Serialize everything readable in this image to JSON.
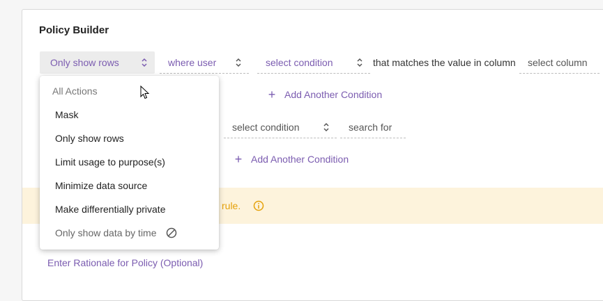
{
  "builder": {
    "title": "Policy Builder"
  },
  "row1": {
    "action_select": "Only show rows",
    "user_select": "where user",
    "condition_select": "select condition",
    "middle_text": "that matches the value in column",
    "column_select": "select column"
  },
  "add_condition_1": "Add Another Condition",
  "row2": {
    "condition_select": "select condition",
    "search_input": "search for"
  },
  "add_condition_2": "Add Another Condition",
  "warning": {
    "text": "rule.",
    "color": "#e5a10a"
  },
  "rationale_link": "Enter Rationale for Policy (Optional)",
  "dropdown": {
    "header": "All Actions",
    "items": [
      "Mask",
      "Only show rows",
      "Limit usage to purpose(s)",
      "Minimize data source",
      "Make differentially private"
    ],
    "disabled_item": "Only show data by time"
  },
  "colors": {
    "accent": "#7b5cb0",
    "warning_bg": "#fdf3dc"
  }
}
